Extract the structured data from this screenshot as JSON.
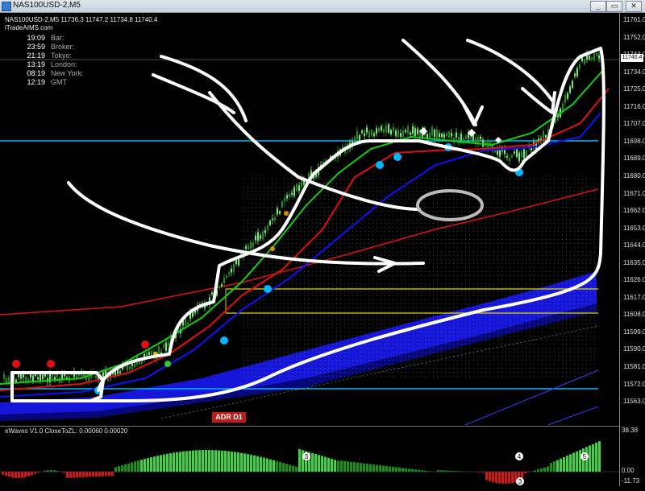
{
  "window": {
    "title": "NAS100USD-2,M5",
    "buttons": {
      "minimize": "_",
      "maximize": "▭",
      "close": "✕"
    }
  },
  "chart": {
    "symbol_line": "NAS100USD-2,M5  11736.3 11747.2 11734.8 11740.4",
    "brand": "iTradeAIMS.com",
    "current_price": "11740.4",
    "adr_badge": "ADR D1",
    "clocks": [
      {
        "time": "19:09",
        "name": "Bar:"
      },
      {
        "time": "23:59",
        "name": "Broker:"
      },
      {
        "time": "21:19",
        "name": "Tokyo:"
      },
      {
        "time": "13:19",
        "name": "London:"
      },
      {
        "time": "08:19",
        "name": "New York:"
      },
      {
        "time": "12:19",
        "name": "GMT"
      }
    ],
    "price_axis": [
      "11761.0",
      "11752.0",
      "11743.0",
      "11734.0",
      "11725.0",
      "11716.0",
      "11707.0",
      "11698.0",
      "11689.0",
      "11680.0",
      "11671.0",
      "11662.0",
      "11653.0",
      "11644.0",
      "11635.0",
      "11626.0",
      "11617.0",
      "11608.0",
      "11599.0",
      "11590.0",
      "11581.0",
      "11572.0",
      "11563.0"
    ],
    "colors": {
      "bull_candle": "#6cf06c",
      "bear_candle": "#1e8c1e",
      "ma_blue": "#1010ff",
      "ma_red": "#e01010",
      "ma_green": "#10d010",
      "level_cyan": "#00b7ff",
      "level_yellow": "#e6d600",
      "cloud_blue": "#1a1aff",
      "annotation": "#ffffff"
    }
  },
  "indicator": {
    "label": "eWaves V1.0 CloseToZL: 0.00060 0.00020",
    "axis": [
      "38.38",
      "0.00",
      "-11.73"
    ],
    "markers": [
      "3",
      "4",
      "5",
      "3"
    ]
  }
}
